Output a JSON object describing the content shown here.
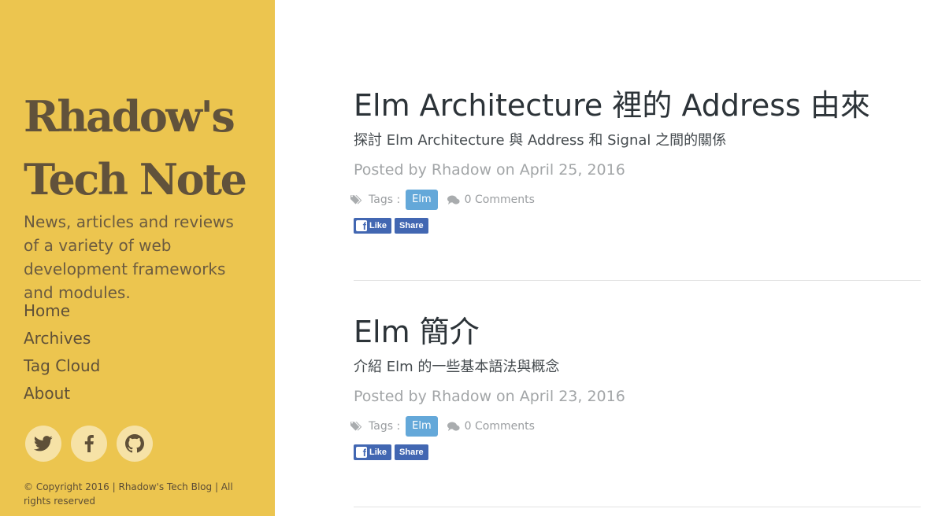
{
  "sidebar": {
    "title_line1": "Rhadow's",
    "title_line2": "Tech Note",
    "description": "News, articles and reviews of a variety of web development frameworks and modules.",
    "nav": [
      {
        "label": "Home"
      },
      {
        "label": "Archives"
      },
      {
        "label": "Tag Cloud"
      },
      {
        "label": "About"
      }
    ],
    "social": [
      {
        "icon": "twitter-icon"
      },
      {
        "icon": "facebook-icon"
      },
      {
        "icon": "github-icon"
      }
    ],
    "copyright": "© Copyright 2016 | Rhadow's Tech Blog | All rights reserved"
  },
  "posts": [
    {
      "title": "Elm Architecture 裡的 Address 由來",
      "subtitle": "探討 Elm Architecture 與 Address 和 Signal 之間的關係",
      "meta": "Posted by Rhadow on April 25, 2016",
      "tags_label": "Tags :",
      "tag": "Elm",
      "comments": "0 Comments",
      "like_label": "Like",
      "share_label": "Share"
    },
    {
      "title": "Elm 簡介",
      "subtitle": "介紹 Elm 的一些基本語法與概念",
      "meta": "Posted by Rhadow on April 23, 2016",
      "tags_label": "Tags :",
      "tag": "Elm",
      "comments": "0 Comments",
      "like_label": "Like",
      "share_label": "Share"
    }
  ],
  "colors": {
    "sidebar_bg": "#ecc54f",
    "tag_badge": "#64a8d9",
    "facebook": "#4267b2"
  }
}
